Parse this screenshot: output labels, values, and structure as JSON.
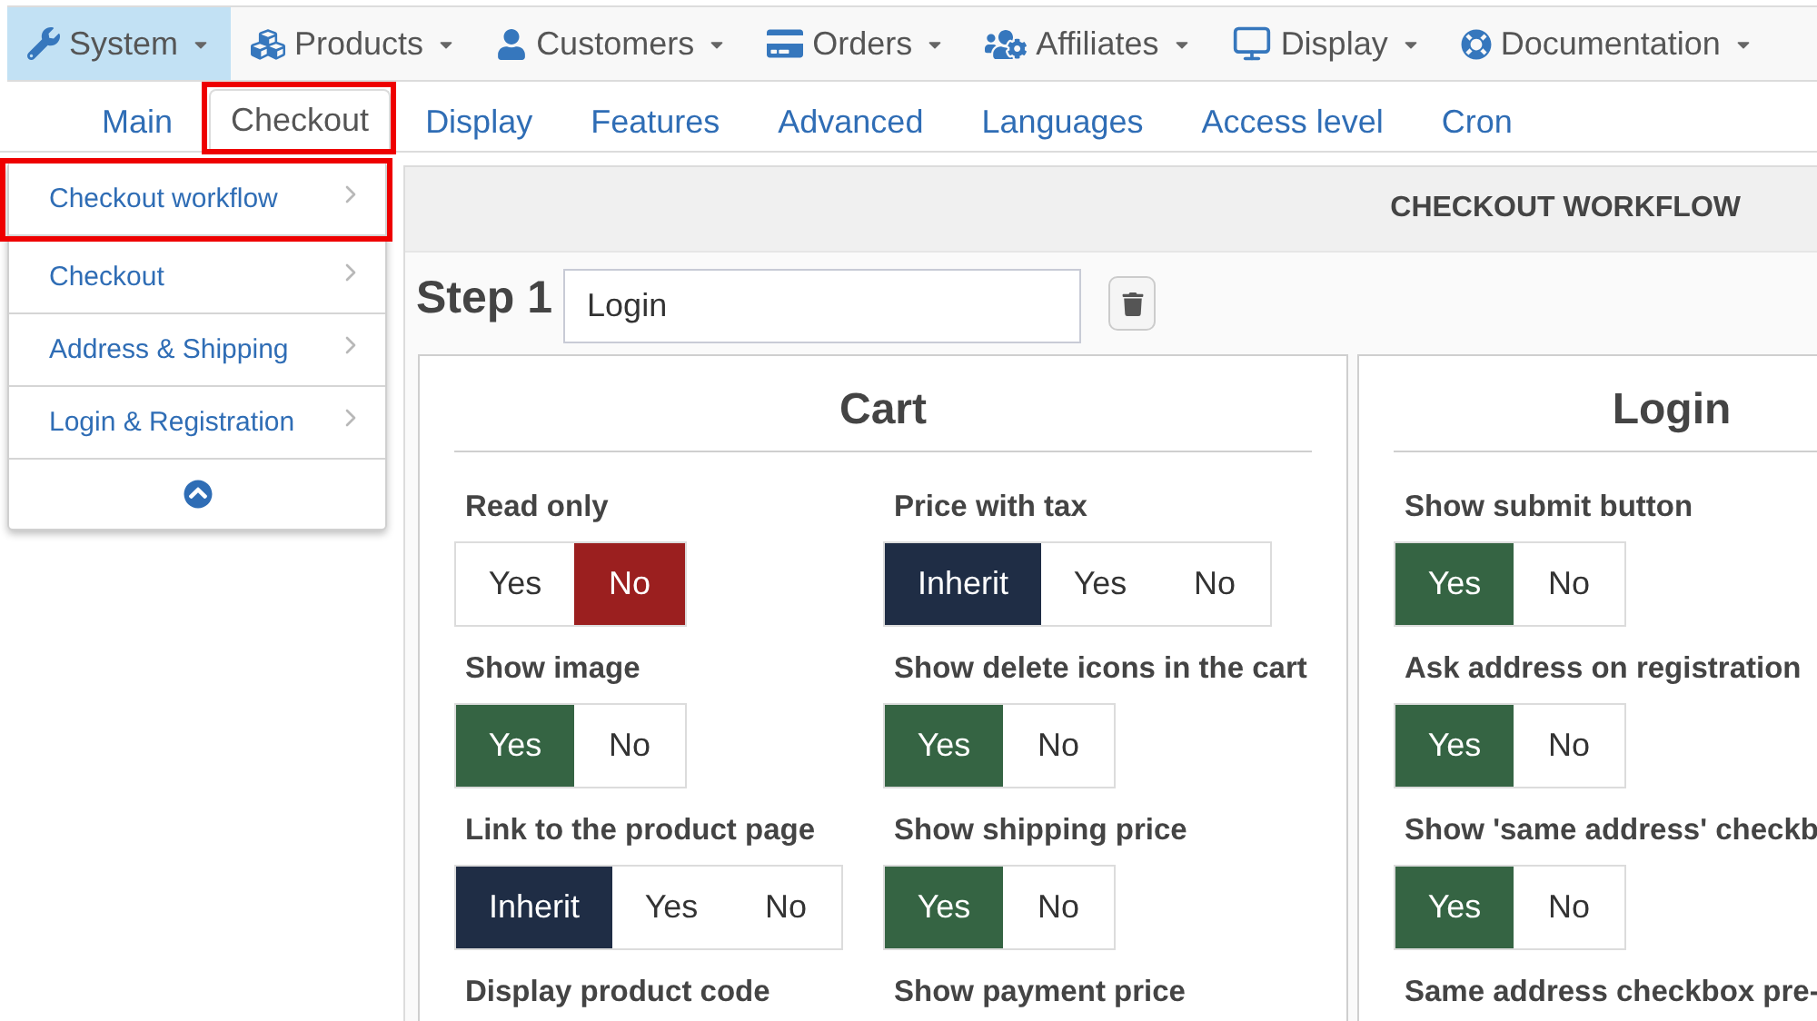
{
  "top_menu": [
    {
      "label": "System",
      "selected": true
    },
    {
      "label": "Products",
      "selected": false
    },
    {
      "label": "Customers",
      "selected": false
    },
    {
      "label": "Orders",
      "selected": false
    },
    {
      "label": "Affiliates",
      "selected": false
    },
    {
      "label": "Display",
      "selected": false
    },
    {
      "label": "Documentation",
      "selected": false
    }
  ],
  "tabs": [
    {
      "label": "Main",
      "selected": false,
      "highlighted": false
    },
    {
      "label": "Checkout",
      "selected": true,
      "highlighted": true
    },
    {
      "label": "Display",
      "selected": false,
      "highlighted": false
    },
    {
      "label": "Features",
      "selected": false,
      "highlighted": false
    },
    {
      "label": "Advanced",
      "selected": false,
      "highlighted": false
    },
    {
      "label": "Languages",
      "selected": false,
      "highlighted": false
    },
    {
      "label": "Access level",
      "selected": false,
      "highlighted": false
    },
    {
      "label": "Cron",
      "selected": false,
      "highlighted": false
    }
  ],
  "sidebar": {
    "items": [
      {
        "label": "Checkout workflow",
        "highlighted": true
      },
      {
        "label": "Checkout",
        "highlighted": false
      },
      {
        "label": "Address & Shipping",
        "highlighted": false
      },
      {
        "label": "Login & Registration",
        "highlighted": false
      }
    ]
  },
  "header": {
    "title": "CHECKOUT WORKFLOW"
  },
  "step": {
    "label": "Step 1",
    "name_field": {
      "value": "Login"
    }
  },
  "panels": [
    {
      "title": "Cart",
      "settings": [
        {
          "label": "Read only",
          "options": [
            {
              "kind": "yes",
              "label": "Yes",
              "selected": false
            },
            {
              "kind": "no",
              "label": "No",
              "selected": true
            }
          ]
        },
        {
          "label": "Price with tax",
          "options": [
            {
              "kind": "inherit",
              "label": "Inherit",
              "selected": true
            },
            {
              "kind": "yes",
              "label": "Yes",
              "selected": false
            },
            {
              "kind": "no",
              "label": "No",
              "selected": false
            }
          ]
        },
        {
          "label": "Show image",
          "options": [
            {
              "kind": "yes",
              "label": "Yes",
              "selected": true
            },
            {
              "kind": "no",
              "label": "No",
              "selected": false
            }
          ]
        },
        {
          "label": "Show delete icons in the cart",
          "options": [
            {
              "kind": "yes",
              "label": "Yes",
              "selected": true
            },
            {
              "kind": "no",
              "label": "No",
              "selected": false
            }
          ]
        },
        {
          "label": "Link to the product page",
          "options": [
            {
              "kind": "inherit",
              "label": "Inherit",
              "selected": true
            },
            {
              "kind": "yes",
              "label": "Yes",
              "selected": false
            },
            {
              "kind": "no",
              "label": "No",
              "selected": false
            }
          ]
        },
        {
          "label": "Show shipping price",
          "options": [
            {
              "kind": "yes",
              "label": "Yes",
              "selected": true
            },
            {
              "kind": "no",
              "label": "No",
              "selected": false
            }
          ]
        },
        {
          "label": "Display product code"
        },
        {
          "label": "Show payment price"
        }
      ]
    },
    {
      "title": "Login",
      "settings": [
        {
          "label": "Show submit button",
          "options": [
            {
              "kind": "yes",
              "label": "Yes",
              "selected": true
            },
            {
              "kind": "no",
              "label": "No",
              "selected": false
            }
          ]
        },
        {
          "label": "Ask address on registration",
          "options": [
            {
              "kind": "yes",
              "label": "Yes",
              "selected": true
            },
            {
              "kind": "no",
              "label": "No",
              "selected": false
            }
          ]
        },
        {
          "label": "Show 'same address' checkb",
          "options": [
            {
              "kind": "yes",
              "label": "Yes",
              "selected": true
            },
            {
              "kind": "no",
              "label": "No",
              "selected": false
            }
          ]
        },
        {
          "label": "Same address checkbox pre-"
        }
      ]
    }
  ]
}
